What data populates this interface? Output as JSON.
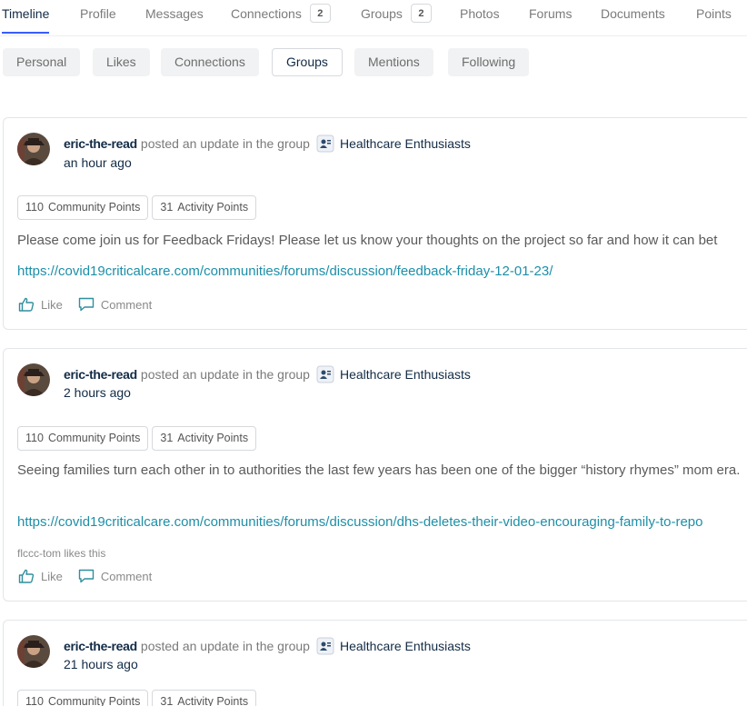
{
  "main_tabs": [
    {
      "label": "Timeline",
      "active": true
    },
    {
      "label": "Profile"
    },
    {
      "label": "Messages"
    },
    {
      "label": "Connections",
      "count": "2"
    },
    {
      "label": "Groups",
      "count": "2"
    },
    {
      "label": "Photos"
    },
    {
      "label": "Forums"
    },
    {
      "label": "Documents"
    },
    {
      "label": "Points"
    }
  ],
  "sub_tabs": [
    {
      "label": "Personal"
    },
    {
      "label": "Likes"
    },
    {
      "label": "Connections"
    },
    {
      "label": "Groups",
      "selected": true
    },
    {
      "label": "Mentions"
    },
    {
      "label": "Following"
    }
  ],
  "activities": [
    {
      "author": "eric-the-read",
      "action": "posted an update in the group",
      "group": "Healthcare Enthusiasts",
      "time": "an hour ago",
      "community_points": {
        "value": "110",
        "label": "Community Points"
      },
      "activity_points": {
        "value": "31",
        "label": "Activity Points"
      },
      "content": "Please come join us for Feedback Fridays! Please let us know your thoughts on the project so far and how it can bet",
      "link": "https://covid19criticalcare.com/communities/forums/discussion/feedback-friday-12-01-23/",
      "like_label": "Like",
      "comment_label": "Comment"
    },
    {
      "author": "eric-the-read",
      "action": "posted an update in the group",
      "group": "Healthcare Enthusiasts",
      "time": "2 hours ago",
      "community_points": {
        "value": "110",
        "label": "Community Points"
      },
      "activity_points": {
        "value": "31",
        "label": "Activity Points"
      },
      "content": "Seeing families turn each other in to authorities the last few years has been one of the bigger “history rhymes” mom era.",
      "link": "https://covid19criticalcare.com/communities/forums/discussion/dhs-deletes-their-video-encouraging-family-to-repo",
      "likes_text": "flccc-tom likes this",
      "like_label": "Like",
      "comment_label": "Comment"
    },
    {
      "author": "eric-the-read",
      "action": "posted an update in the group",
      "group": "Healthcare Enthusiasts",
      "time": "21 hours ago",
      "community_points": {
        "value": "110",
        "label": "Community Points"
      },
      "activity_points": {
        "value": "31",
        "label": "Activity Points"
      }
    }
  ],
  "colors": {
    "accent": "#385dff",
    "link": "#1d8fa8",
    "heading": "#122b46"
  },
  "icons": {
    "group": "group-icon",
    "like": "thumbs-up-icon",
    "comment": "comment-bubble-icon"
  }
}
